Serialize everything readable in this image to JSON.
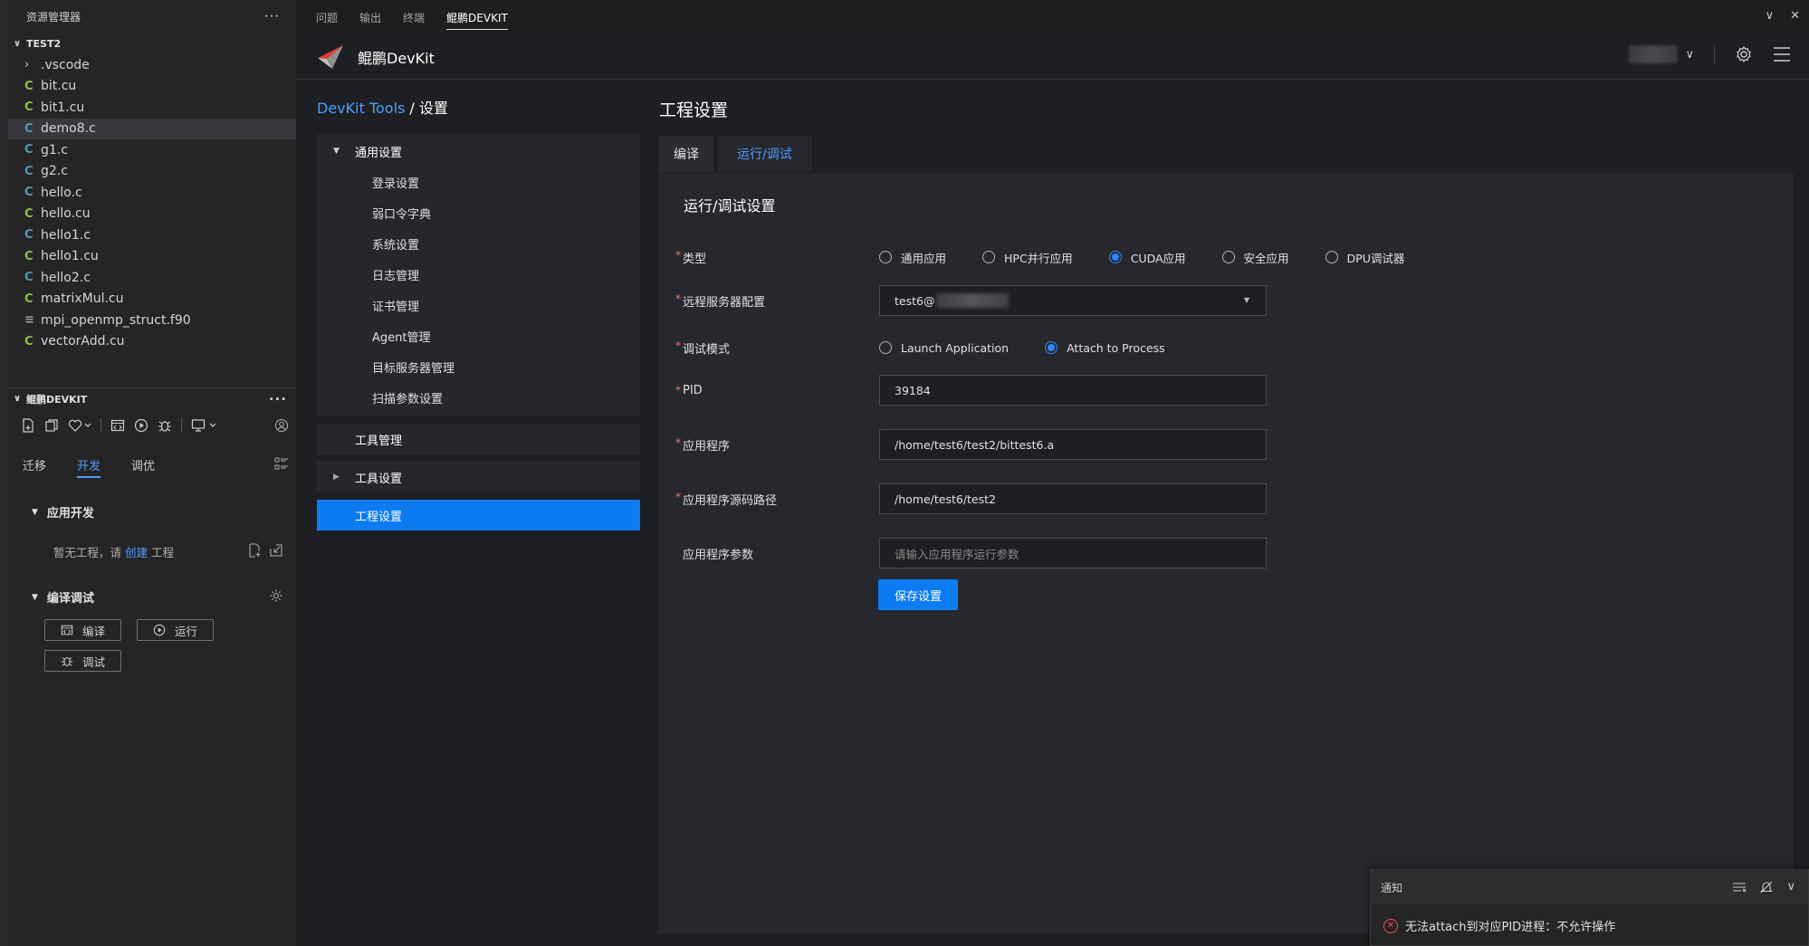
{
  "explorer": {
    "title": "资源管理器",
    "more": "···",
    "folder": "TEST2",
    "files": [
      {
        "name": ".vscode",
        "type": "folder"
      },
      {
        "name": "bit.cu",
        "type": "cu"
      },
      {
        "name": "bit1.cu",
        "type": "cu"
      },
      {
        "name": "demo8.c",
        "type": "c",
        "selected": true
      },
      {
        "name": "g1.c",
        "type": "c"
      },
      {
        "name": "g2.c",
        "type": "c"
      },
      {
        "name": "hello.c",
        "type": "c"
      },
      {
        "name": "hello.cu",
        "type": "cu"
      },
      {
        "name": "hello1.c",
        "type": "c"
      },
      {
        "name": "hello1.cu",
        "type": "cu"
      },
      {
        "name": "hello2.c",
        "type": "c"
      },
      {
        "name": "matrixMul.cu",
        "type": "cu"
      },
      {
        "name": "mpi_openmp_struct.f90",
        "type": "f90"
      },
      {
        "name": "vectorAdd.cu",
        "type": "cu"
      }
    ]
  },
  "devkit_panel": {
    "title": "鲲鹏DEVKIT",
    "more": "···",
    "tabs": [
      "迁移",
      "开发",
      "调优"
    ],
    "active_tab": "开发",
    "app_dev": {
      "title": "应用开发",
      "empty_prefix": "暂无工程，请",
      "create_link": "创建",
      "empty_suffix": "工程"
    },
    "compile_debug": {
      "title": "编译调试",
      "compile": "编译",
      "run": "运行",
      "debug": "调试"
    }
  },
  "topbar": {
    "tabs": [
      "问题",
      "输出",
      "终端",
      "鲲鹏DEVKIT"
    ],
    "active": "鲲鹏DEVKIT"
  },
  "app": {
    "title": "鲲鹏DevKit"
  },
  "breadcrumb": {
    "link": "DevKit Tools",
    "sep": " / ",
    "current": "设置"
  },
  "settings_nav": {
    "general": "通用设置",
    "items": [
      "登录设置",
      "弱口令字典",
      "系统设置",
      "日志管理",
      "证书管理",
      "Agent管理",
      "目标服务器管理",
      "扫描参数设置"
    ],
    "tool_mgmt": "工具管理",
    "tool_settings": "工具设置",
    "project_settings": "工程设置"
  },
  "project": {
    "title": "工程设置",
    "tabs": [
      "编译",
      "运行/调试"
    ],
    "active_tab": "运行/调试",
    "panel_title": "运行/调试设置",
    "type_label": "类型",
    "type_options": [
      "通用应用",
      "HPC并行应用",
      "CUDA应用",
      "安全应用",
      "DPU调试器"
    ],
    "type_selected": "CUDA应用",
    "remote_label": "远程服务器配置",
    "remote_value": "test6@",
    "mode_label": "调试模式",
    "mode_options": [
      "Launch Application",
      "Attach to Process"
    ],
    "mode_selected": "Attach to Process",
    "pid_label": "PID",
    "pid_value": "39184",
    "app_label": "应用程序",
    "app_value": "/home/test6/test2/bittest6.a",
    "src_label": "应用程序源码路径",
    "src_value": "/home/test6/test2",
    "args_label": "应用程序参数",
    "args_placeholder": "请输入应用程序运行参数",
    "save": "保存设置"
  },
  "notification": {
    "title": "通知",
    "message": "无法attach到对应PID进程：不允许操作"
  },
  "colors": {
    "accent": "#0d7cf2",
    "link": "#4e9dff",
    "error": "#f14c4c",
    "required": "#f56c6c"
  }
}
